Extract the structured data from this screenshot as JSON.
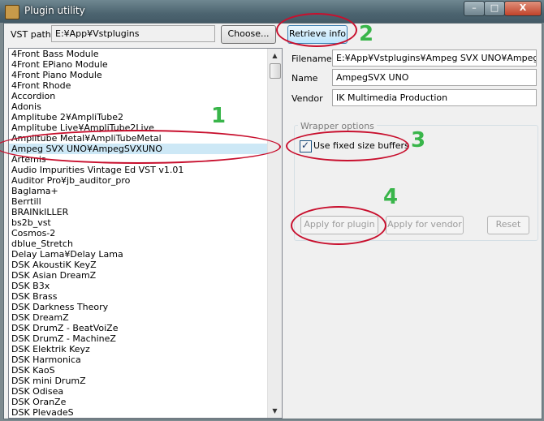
{
  "window": {
    "title": "Plugin utility",
    "min_glyph": "–",
    "max_glyph": "□",
    "close_glyph": "X"
  },
  "vst": {
    "label": "VST path",
    "path": "E:¥App¥Vstplugins",
    "choose_label": "Choose...",
    "retrieve_label": "Retrieve info"
  },
  "plugins": [
    "4Front Bass Module",
    "4Front EPiano Module",
    "4Front Piano Module",
    "4Front Rhode",
    "Accordion",
    "Adonis",
    "Amplitube 2¥AmpliTube2",
    "Amplitube Live¥AmpliTube2Live",
    "Amplitube Metal¥AmpliTubeMetal",
    "Ampeg SVX UNO¥AmpegSVXUNO",
    "Artemis",
    "Audio Impurities Vintage Ed VST v1.01",
    "Auditor Pro¥jb_auditor_pro",
    "Baglama+",
    "Berrtill",
    "BRAINkILLER",
    "bs2b_vst",
    "Cosmos-2",
    "dblue_Stretch",
    "Delay Lama¥Delay Lama",
    "DSK AkoustiK KeyZ",
    "DSK Asian DreamZ",
    "DSK B3x",
    "DSK Brass",
    "DSK Darkness Theory",
    "DSK DreamZ",
    "DSK DrumZ - BeatVoiZe",
    "DSK DrumZ - MachineZ",
    "DSK Elektrik Keyz",
    "DSK Harmonica",
    "DSK KaoS",
    "DSK mini DrumZ",
    "DSK Odisea",
    "DSK OranZe",
    "DSK PlevadeS"
  ],
  "selected_plugin": "Ampeg SVX UNO¥AmpegSVXUNO",
  "info": {
    "filename_label": "Filename",
    "filename": "E:¥App¥Vstplugins¥Ampeg SVX UNO¥AmpegSVXUNO",
    "name_label": "Name",
    "name": "AmpegSVX UNO",
    "vendor_label": "Vendor",
    "vendor": "IK Multimedia Production"
  },
  "wrapper": {
    "group_label": "Wrapper options",
    "fixed_buffers_label": "Use fixed size buffers",
    "fixed_buffers_checked": true,
    "apply_plugin_label": "Apply for plugin",
    "apply_vendor_label": "Apply for vendor",
    "reset_label": "Reset"
  },
  "annotations": {
    "marks": [
      "1",
      "2",
      "3",
      "4"
    ],
    "circle_color": "#c8102e",
    "number_color": "#39b54a"
  }
}
